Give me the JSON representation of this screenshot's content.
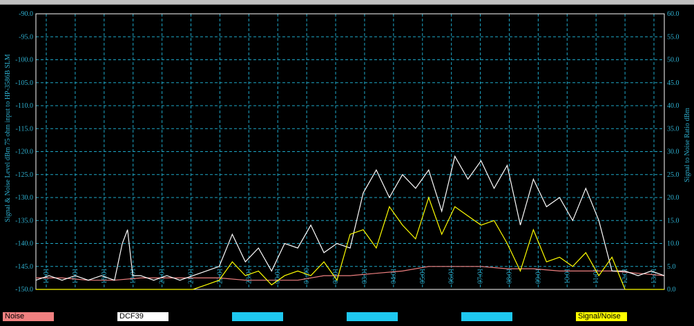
{
  "colors": {
    "background": "#000000",
    "grid": "#1ea7c8",
    "axis_text": "#2fb0d0",
    "noise": "#f08080",
    "signal": "#ffffff",
    "snr": "#ffff00",
    "blank_legend": "#1ec8f0"
  },
  "chart_data": {
    "type": "line",
    "ylabel": "Signal & Noise Level  dBm 75 ohm input to HP-3586B SLM",
    "y2label": "Signal to Noise Ratio  dBm",
    "ylim": [
      -150,
      -90
    ],
    "y2lim": [
      0,
      60
    ],
    "yticks": [
      "-90.0",
      "-95.0",
      "-100.0",
      "-105.0",
      "-110.0",
      "-115.0",
      "-120.0",
      "-125.0",
      "-130.0",
      "-135.0",
      "-140.0",
      "-145.0",
      "-150.0"
    ],
    "y2ticks": [
      "60.0",
      "55.0",
      "50.0",
      "45.0",
      "40.0",
      "35.0",
      "30.0",
      "25.0",
      "20.0",
      "15.0",
      "10.0",
      "5.0",
      "0.0"
    ],
    "xlim": [
      0,
      24
    ],
    "xticks": [
      "16:01",
      "17:01",
      "18:01",
      "19:01",
      "20:01",
      "21:01",
      "22:01",
      "23:01",
      "00:01",
      "01:00",
      "02:01",
      "03:01",
      "04:01",
      "05:01",
      "06:01",
      "07:01",
      "08:01",
      "09:01",
      "10:01",
      "11:01",
      "12:01",
      "13:01"
    ],
    "grid": true,
    "legend_position": "bottom",
    "legend": [
      "Noise",
      "DCF39",
      "",
      "",
      "",
      "Signal/Noise"
    ],
    "series": [
      {
        "name": "Noise",
        "y_axis": "left",
        "x": [
          0,
          1,
          2,
          3,
          4,
          5,
          6,
          7,
          8,
          9,
          10,
          11,
          12,
          13,
          14,
          15,
          16,
          17,
          18,
          19,
          20,
          21,
          22,
          23,
          24
        ],
        "values": [
          -147.5,
          -147.5,
          -148,
          -148,
          -147.5,
          -147.5,
          -147.5,
          -147.5,
          -148,
          -148,
          -148,
          -147,
          -147,
          -146.5,
          -146,
          -145,
          -145,
          -145,
          -145.5,
          -145.5,
          -146,
          -146,
          -146,
          -146.5,
          -147
        ]
      },
      {
        "name": "DCF39",
        "y_axis": "left",
        "x": [
          0,
          0.5,
          1,
          1.5,
          2,
          2.5,
          3,
          3.3,
          3.5,
          3.7,
          4,
          4.5,
          5,
          5.5,
          6,
          6.5,
          7,
          7.5,
          8,
          8.5,
          9,
          9.5,
          10,
          10.5,
          11,
          11.5,
          12,
          12.5,
          13,
          13.5,
          14,
          14.5,
          15,
          15.5,
          16,
          16.5,
          17,
          17.5,
          18,
          18.5,
          19,
          19.5,
          20,
          20.5,
          21,
          21.5,
          22,
          22.5,
          23,
          23.5,
          24
        ],
        "values": [
          -148,
          -147,
          -148,
          -147,
          -148,
          -147,
          -148,
          -140,
          -137,
          -147,
          -147,
          -148,
          -147,
          -148,
          -147,
          -146,
          -145,
          -138,
          -144,
          -141,
          -146,
          -140,
          -141,
          -136,
          -142,
          -140,
          -141,
          -129,
          -124,
          -130,
          -125,
          -128,
          -124,
          -133,
          -121,
          -126,
          -122,
          -128,
          -123,
          -136,
          -126,
          -132,
          -130,
          -135,
          -128,
          -135,
          -146,
          -146,
          -147,
          -146,
          -147
        ]
      },
      {
        "name": "Signal/Noise",
        "y_axis": "right",
        "x": [
          0,
          6,
          6.5,
          7,
          7.5,
          8,
          8.5,
          9,
          9.5,
          10,
          10.5,
          11,
          11.5,
          12,
          12.5,
          13,
          13.5,
          14,
          14.5,
          15,
          15.5,
          16,
          16.5,
          17,
          17.5,
          18,
          18.5,
          19,
          19.5,
          20,
          20.5,
          21,
          21.5,
          22,
          22.5,
          23,
          24
        ],
        "values": [
          0,
          0,
          1,
          2,
          6,
          3,
          4,
          1,
          3,
          4,
          3,
          6,
          2,
          12,
          13,
          9,
          18,
          14,
          11,
          20,
          12,
          18,
          16,
          14,
          15,
          10,
          4,
          13,
          6,
          7,
          5,
          8,
          3,
          7,
          0,
          0,
          0
        ]
      }
    ]
  }
}
